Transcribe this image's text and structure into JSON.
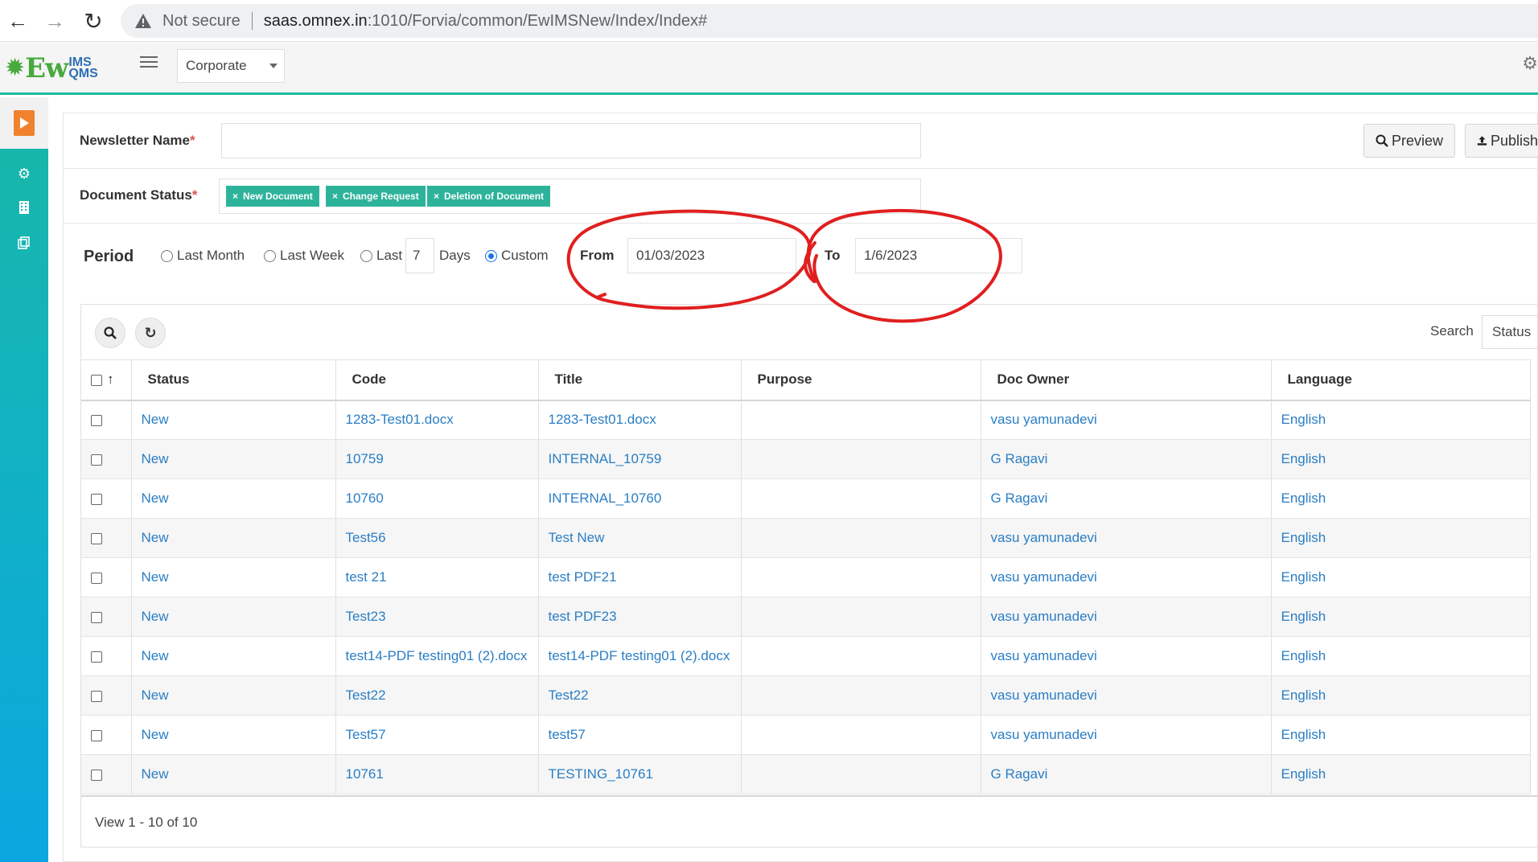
{
  "browser": {
    "security": "Not secure",
    "url_host": "saas.omnex.in",
    "url_path": ":1010/Forvia/common/EwIMSNew/Index/Index#"
  },
  "header": {
    "logo_main": "Ew",
    "logo_top": "IMS",
    "logo_bottom": "QMS",
    "org_selected": "Corporate"
  },
  "form": {
    "newsletter_label": "Newsletter Name",
    "required_mark": "*",
    "newsletter_value": "",
    "doc_status_label": "Document Status",
    "doc_status_tags": [
      "New Document",
      "Change Request",
      "Deletion of Document"
    ],
    "preview_label": "Preview",
    "publish_label": "Publish"
  },
  "period": {
    "label": "Period",
    "options": [
      "Last Month",
      "Last Week",
      "Last",
      "Custom"
    ],
    "selected": "Custom",
    "days_value": "7",
    "days_label": "Days",
    "from_label": "From",
    "from_value": "01/03/2023",
    "to_label": "To",
    "to_value": "1/6/2023"
  },
  "grid": {
    "search_label": "Search",
    "search_field": "Status",
    "columns": [
      "Status",
      "Code",
      "Title",
      "Purpose",
      "Doc Owner",
      "Language"
    ],
    "rows": [
      {
        "status": "New",
        "code": "1283-Test01.docx",
        "title": "1283-Test01.docx",
        "purpose": "",
        "owner": "vasu yamunadevi",
        "language": "English"
      },
      {
        "status": "New",
        "code": "10759",
        "title": "INTERNAL_10759",
        "purpose": "",
        "owner": "G Ragavi",
        "language": "English"
      },
      {
        "status": "New",
        "code": "10760",
        "title": "INTERNAL_10760",
        "purpose": "",
        "owner": "G Ragavi",
        "language": "English"
      },
      {
        "status": "New",
        "code": "Test56",
        "title": "Test New",
        "purpose": "",
        "owner": "vasu yamunadevi",
        "language": "English"
      },
      {
        "status": "New",
        "code": "test 21",
        "title": "test PDF21",
        "purpose": "",
        "owner": "vasu yamunadevi",
        "language": "English"
      },
      {
        "status": "New",
        "code": "Test23",
        "title": "test PDF23",
        "purpose": "",
        "owner": "vasu yamunadevi",
        "language": "English"
      },
      {
        "status": "New",
        "code": "test14-PDF testing01 (2).docx",
        "title": "test14-PDF testing01 (2).docx",
        "purpose": "",
        "owner": "vasu yamunadevi",
        "language": "English"
      },
      {
        "status": "New",
        "code": "Test22",
        "title": "Test22",
        "purpose": "",
        "owner": "vasu yamunadevi",
        "language": "English"
      },
      {
        "status": "New",
        "code": "Test57",
        "title": "test57",
        "purpose": "",
        "owner": "vasu yamunadevi",
        "language": "English"
      },
      {
        "status": "New",
        "code": "10761",
        "title": "TESTING_10761",
        "purpose": "",
        "owner": "G Ragavi",
        "language": "English"
      }
    ],
    "footer": "View 1 - 10 of 10"
  },
  "colors": {
    "accent_teal": "#1abc9c",
    "tag_green": "#2eb39b",
    "link_blue": "#2a7ec4",
    "annotation_red": "#e01f1f"
  }
}
